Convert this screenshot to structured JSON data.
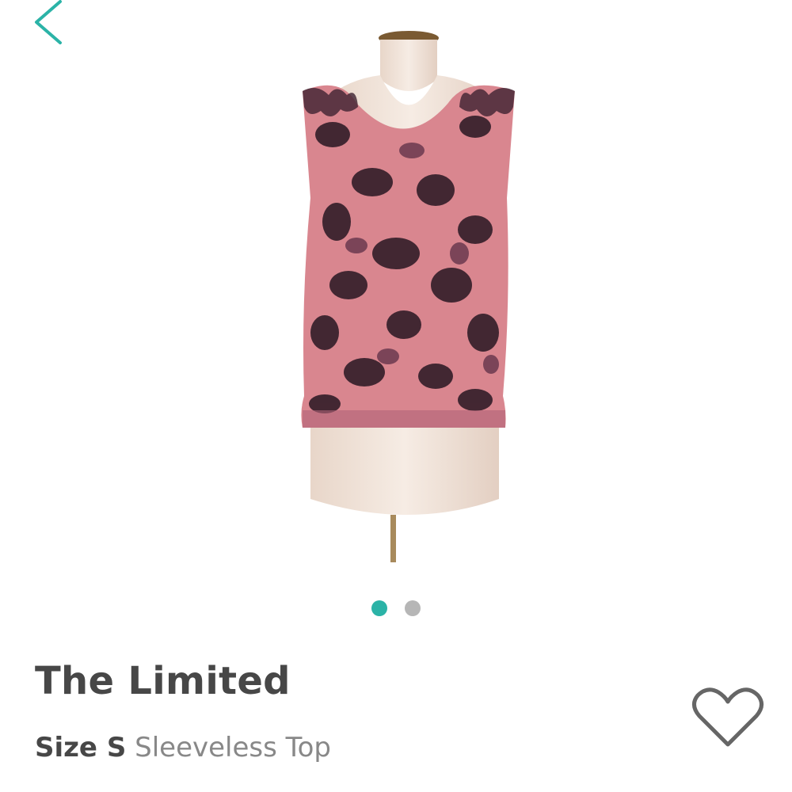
{
  "nav": {
    "back_icon": "chevron-left-icon",
    "accent": "#2bb3a7"
  },
  "gallery": {
    "image_description": "floral-print-sleeveless-top-on-mannequin",
    "slide_count": 2,
    "active_slide": 1
  },
  "product": {
    "brand": "The Limited",
    "size_label": "Size S",
    "category": "Sleeveless Top"
  },
  "actions": {
    "favorite_icon": "heart-outline-icon"
  },
  "colors": {
    "accent": "#2bb3a7",
    "inactive_dot": "#b6b6b6",
    "brand_text": "#474747",
    "muted_text": "#888888",
    "garment_pink": "#d9868f",
    "garment_dark": "#2e1a26"
  }
}
